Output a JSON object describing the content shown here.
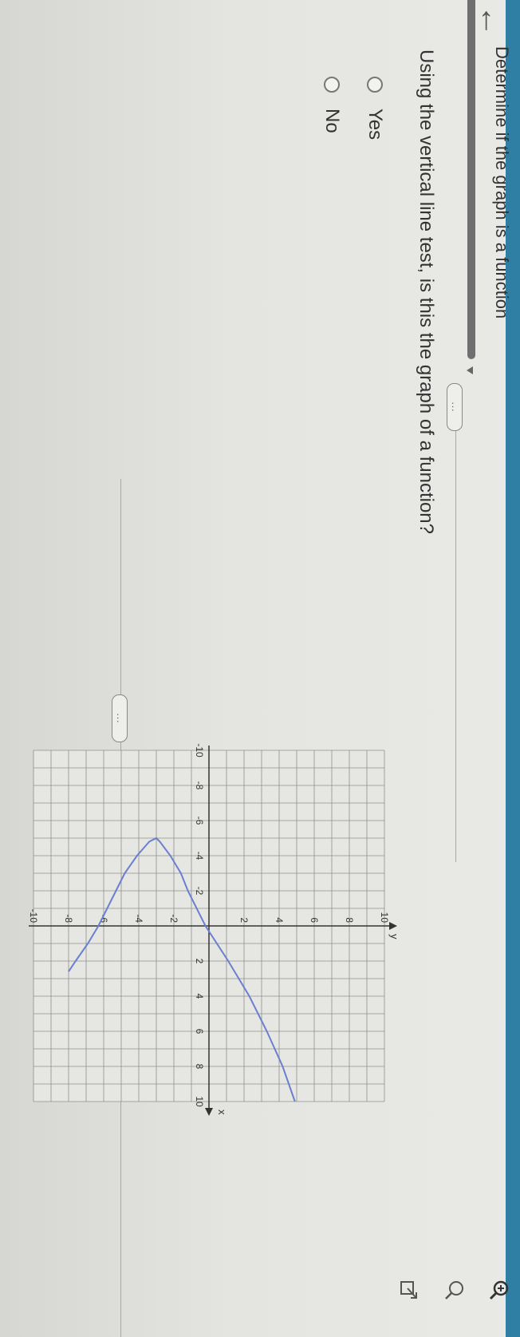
{
  "header": {
    "title": "Determine if the graph is a function",
    "back_icon": "back-arrow-icon",
    "tool_icons": [
      "zoom-in-icon",
      "search-icon",
      "popout-icon"
    ]
  },
  "question": {
    "text": "Using the vertical line test, is this the graph of a function?",
    "options": [
      {
        "label": "Yes"
      },
      {
        "label": "No"
      }
    ]
  },
  "expander_label": "...",
  "colors": {
    "curve": "#6a7fd0",
    "accent": "#2f7fa5",
    "grid": "#8f8f8f"
  },
  "chart_data": {
    "type": "line",
    "xlabel": "x",
    "ylabel": "y",
    "xlim": [
      -10,
      10
    ],
    "ylim": [
      -10,
      10
    ],
    "grid": true,
    "x_ticks": [
      -10,
      -8,
      -6,
      -4,
      -2,
      2,
      4,
      6,
      8,
      10
    ],
    "y_ticks": [
      10,
      8,
      6,
      4,
      2,
      -2,
      -4,
      -6,
      -8,
      -10
    ],
    "x_tick_labels": [
      "-10",
      "-8",
      "-6",
      "-4",
      "-2",
      "2",
      "4",
      "6",
      "8",
      "10"
    ],
    "y_tick_labels": [
      "10",
      "8",
      "6",
      "4",
      "2",
      "-2",
      "-4",
      "-6",
      "-8",
      "-10"
    ],
    "series": [
      {
        "description_shape": "sideways parabola opening right, vertex (-5, -3)",
        "points": [
          [
            10,
            4.9
          ],
          [
            8,
            4.2
          ],
          [
            6,
            3.3
          ],
          [
            4,
            2.3
          ],
          [
            2,
            1.1
          ],
          [
            0,
            -0.2
          ],
          [
            -2,
            -1.2
          ],
          [
            -3,
            -1.6
          ],
          [
            -4,
            -2.2
          ],
          [
            -4.8,
            -2.8
          ],
          [
            -5,
            -3
          ],
          [
            -4.8,
            -3.4
          ],
          [
            -4,
            -4.1
          ],
          [
            -3,
            -4.8
          ],
          [
            -2,
            -5.3
          ],
          [
            -1,
            -5.8
          ],
          [
            0,
            -6.3
          ],
          [
            1,
            -6.9
          ],
          [
            2,
            -7.6
          ],
          [
            2.6,
            -8.0
          ]
        ]
      }
    ]
  }
}
